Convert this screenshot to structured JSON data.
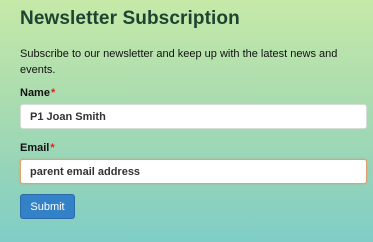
{
  "form": {
    "title": "Newsletter Subscription",
    "description": "Subscribe to our newsletter and keep up with the latest news and events.",
    "required_marker": "*",
    "name_label": "Name",
    "name_value": "P1 Joan Smith",
    "email_label": "Email",
    "email_value": "parent email address",
    "submit_label": "Submit"
  },
  "colors": {
    "title": "#1c4430",
    "required": "#dd2222",
    "button": "#3381c7",
    "focus_border": "#e2a06a"
  }
}
